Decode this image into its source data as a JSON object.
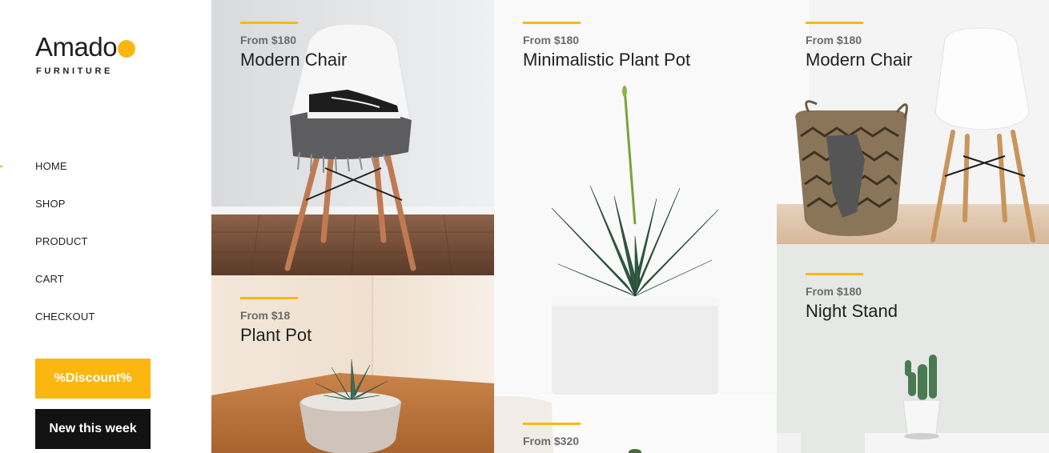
{
  "brand": {
    "name": "Amado",
    "tagline": "FURNITURE",
    "accent": "#fbb710"
  },
  "nav": {
    "items": [
      {
        "label": "HOME",
        "active": true
      },
      {
        "label": "SHOP"
      },
      {
        "label": "PRODUCT"
      },
      {
        "label": "CART"
      },
      {
        "label": "CHECKOUT"
      }
    ]
  },
  "buttons": {
    "discount": "%Discount%",
    "new_week": "New this week"
  },
  "products": [
    {
      "price": "From $180",
      "name": "Modern Chair"
    },
    {
      "price": "From $18",
      "name": "Plant Pot"
    },
    {
      "price": "From $180",
      "name": "Minimalistic Plant Pot"
    },
    {
      "price": "From $320",
      "name": ""
    },
    {
      "price": "From $180",
      "name": "Modern Chair"
    },
    {
      "price": "From $180",
      "name": "Night Stand"
    }
  ]
}
